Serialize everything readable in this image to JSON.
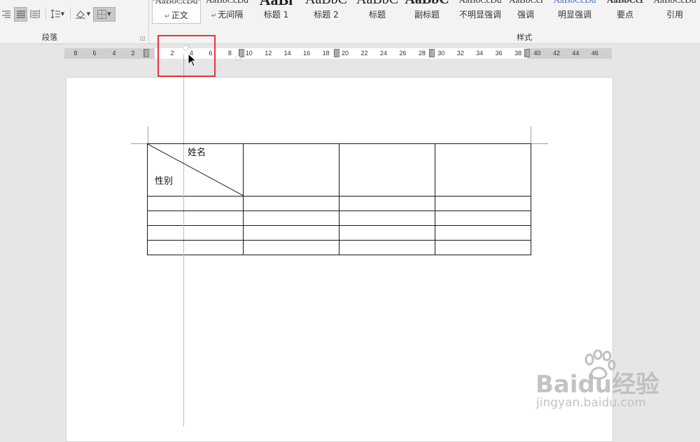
{
  "paragraph_group": {
    "label": "段落",
    "tools": [
      {
        "icon": "align-right-icon",
        "active": false
      },
      {
        "icon": "justify-icon",
        "active": true
      },
      {
        "icon": "distributed-icon",
        "active": false
      },
      {
        "icon": "line-spacing-icon",
        "active": false
      },
      {
        "icon": "shading-icon",
        "active": false
      },
      {
        "icon": "borders-icon",
        "active": false
      }
    ]
  },
  "styles_group": {
    "label": "样式",
    "items": [
      {
        "preview": "AaBbCcDd",
        "label": "正文",
        "selected": true,
        "pilcrow": true
      },
      {
        "preview": "AaBbCcDd",
        "label": "无间隔",
        "selected": false,
        "pilcrow": true
      },
      {
        "preview": "AaBl",
        "label": "标题 1",
        "selected": false
      },
      {
        "preview": "AaBbC",
        "label": "标题 2",
        "selected": false
      },
      {
        "preview": "AaBbC",
        "label": "标题",
        "selected": false
      },
      {
        "preview": "AaBbC",
        "label": "副标题",
        "selected": false
      },
      {
        "preview": "AaBbCcDd",
        "label": "不明显强调",
        "selected": false
      },
      {
        "preview": "AaBbCcDd",
        "label": "强调",
        "selected": false
      },
      {
        "preview": "AaBbCcDd",
        "label": "明显强调",
        "selected": false
      },
      {
        "preview": "AaBbCcDd",
        "label": "要点",
        "selected": false
      },
      {
        "preview": "AaBbCcDd",
        "label": "引用",
        "selected": false
      }
    ]
  },
  "ruler": {
    "ticks_left": [
      "8",
      "6",
      "4",
      "2"
    ],
    "ticks_right": [
      "2",
      "4",
      "6",
      "8",
      "10",
      "12",
      "14",
      "16",
      "18",
      "20",
      "22",
      "24",
      "26",
      "28",
      "30",
      "32",
      "34",
      "36",
      "38",
      "40",
      "42",
      "44",
      "46"
    ]
  },
  "table": {
    "diagonal_header_top": "姓名",
    "diagonal_header_bottom": "性别",
    "columns": 4,
    "body_rows": 4
  },
  "watermark": {
    "brand": "Baidu经验",
    "url": "jingyan.baidu.com"
  },
  "colors": {
    "highlight_box": "#e8333b",
    "ribbon": "#f3f3f3",
    "workspace": "#e6e6e6"
  }
}
